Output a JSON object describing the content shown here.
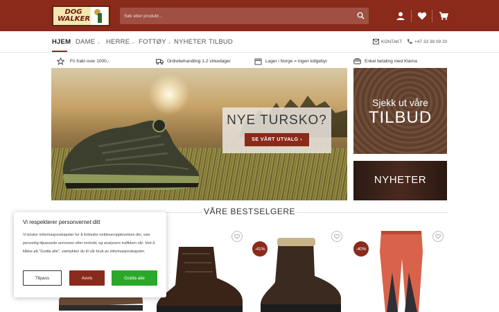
{
  "header": {
    "logo_line1": "DOG",
    "logo_line2": "WALKER",
    "search_placeholder": "Søk etter produkt..."
  },
  "nav": {
    "items": [
      {
        "label": "HJEM",
        "active": true
      },
      {
        "label": "DAME",
        "dropdown": true
      },
      {
        "label": "HERRE",
        "dropdown": true
      },
      {
        "label": "FOTTØY",
        "dropdown": true
      },
      {
        "label": "NYHETER"
      },
      {
        "label": "TILBUD"
      }
    ],
    "contact_label": "KONTAKT",
    "phone": "+47 33 38 09 20"
  },
  "usps": [
    {
      "icon": "star-icon",
      "text": "Fri frakt over 1000,-"
    },
    {
      "icon": "truck-icon",
      "text": "Ordrebehandling 1-2 virkedager"
    },
    {
      "icon": "box-icon",
      "text": "Lager i Norge = ingen tollgebyr"
    },
    {
      "icon": "payment-icon",
      "text": "Enkel betaling med Klarna"
    }
  ],
  "hero": {
    "title": "NYE TURSKO?",
    "button": "SE VÅRT UTVALG"
  },
  "promos": {
    "offers_small": "Sjekk ut våre",
    "offers_big": "TILBUD",
    "news": "NYHETER"
  },
  "bestsellers": {
    "title": "VÅRE BESTSELGERE",
    "products": [
      {
        "badge": ""
      },
      {
        "badge": ""
      },
      {
        "badge": "-41%"
      },
      {
        "badge": "-40%"
      }
    ]
  },
  "cookie": {
    "title": "Vi respekterer personvernet ditt",
    "text": "Vi bruker informasjonskapsler for å forbedre nettleseropplevelsen din, vise personlig tilpassede annonser eller innhold, og analysere trafikken vår. Ved å klikke på \"Godta alle\", samtykker du til vår bruk av informasjonskapsler.",
    "customize": "Tilpass",
    "reject": "Avvis",
    "accept": "Godta alle"
  },
  "colors": {
    "brand": "#8a2a1a",
    "accept_button": "#2aa82a"
  }
}
